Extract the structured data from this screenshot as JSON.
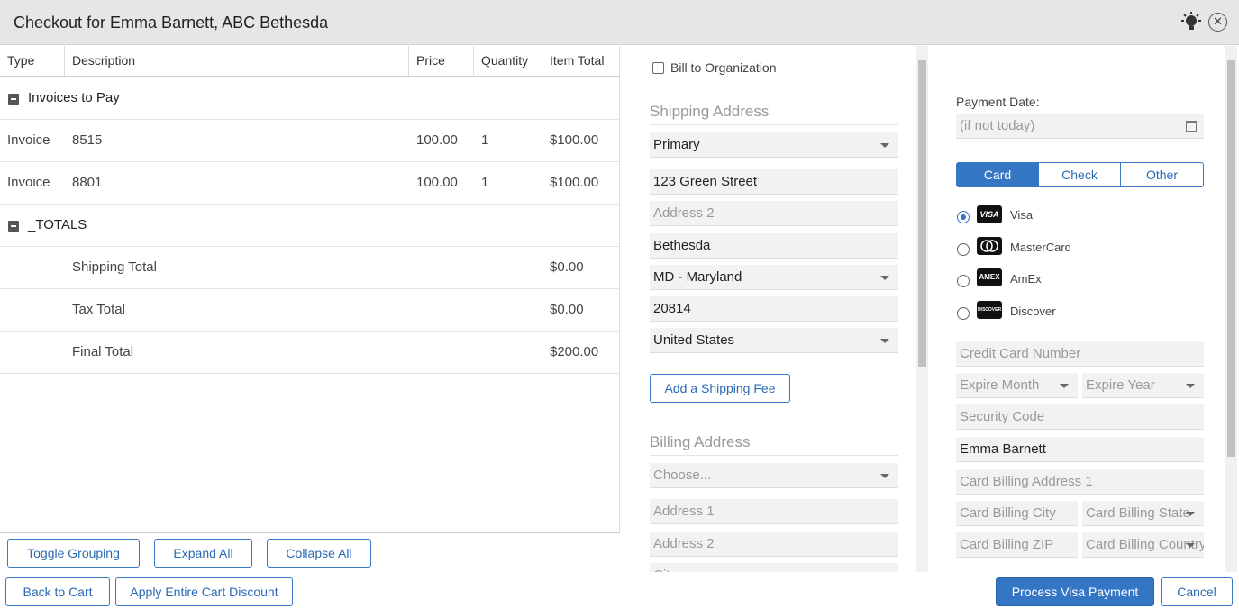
{
  "window": {
    "title": "Checkout for Emma Barnett, ABC Bethesda"
  },
  "table": {
    "headers": [
      "Type",
      "Description",
      "Price",
      "Quantity",
      "Item Total"
    ],
    "groups": [
      {
        "label": "Invoices to Pay",
        "rows": [
          {
            "type": "Invoice",
            "description": "8515",
            "price": "100.00",
            "quantity": "1",
            "total": "$100.00"
          },
          {
            "type": "Invoice",
            "description": "8801",
            "price": "100.00",
            "quantity": "1",
            "total": "$100.00"
          }
        ]
      },
      {
        "label": "_TOTALS",
        "rows": [
          {
            "type": "",
            "description": "Shipping Total",
            "price": "",
            "quantity": "",
            "total": "$0.00"
          },
          {
            "type": "",
            "description": "Tax Total",
            "price": "",
            "quantity": "",
            "total": "$0.00"
          },
          {
            "type": "",
            "description": "Final Total",
            "price": "",
            "quantity": "",
            "total": "$200.00"
          }
        ]
      }
    ],
    "buttons": {
      "toggle_grouping": "Toggle Grouping",
      "expand_all": "Expand All",
      "collapse_all": "Collapse All"
    }
  },
  "shipping": {
    "bill_to_org_label": "Bill to Organization",
    "heading": "Shipping Address",
    "address_type": "Primary",
    "address1": "123 Green Street",
    "address2_placeholder": "Address 2",
    "city": "Bethesda",
    "state": "MD - Maryland",
    "zip": "20814",
    "country": "United States",
    "add_fee_button": "Add a Shipping Fee"
  },
  "billing": {
    "heading": "Billing Address",
    "choose_placeholder": "Choose...",
    "address1_placeholder": "Address 1",
    "address2_placeholder": "Address 2",
    "city_placeholder": "City"
  },
  "payment": {
    "date_label": "Payment Date:",
    "date_placeholder": "(if not today)",
    "tabs": [
      "Card",
      "Check",
      "Other"
    ],
    "selected_tab": "Card",
    "cards": [
      {
        "name": "Visa",
        "logo": "VISA",
        "selected": true
      },
      {
        "name": "MasterCard",
        "logo": "MC",
        "selected": false
      },
      {
        "name": "AmEx",
        "logo": "AMEX",
        "selected": false
      },
      {
        "name": "Discover",
        "logo": "DISCOVER",
        "selected": false
      }
    ],
    "card_number_placeholder": "Credit Card Number",
    "expire_month_placeholder": "Expire Month",
    "expire_year_placeholder": "Expire Year",
    "security_code_placeholder": "Security Code",
    "cardholder_name": "Emma Barnett",
    "billing_address1_placeholder": "Card Billing Address 1",
    "billing_city_placeholder": "Card Billing City",
    "billing_state_placeholder": "Card Billing State",
    "billing_zip_placeholder": "Card Billing ZIP",
    "billing_country_placeholder": "Card Billing Country"
  },
  "footer": {
    "back_to_cart": "Back to Cart",
    "apply_discount": "Apply Entire Cart Discount",
    "process_payment": "Process Visa Payment",
    "cancel": "Cancel"
  },
  "colors": {
    "accent": "#3475c4",
    "titlebar": "#e6e6e6",
    "field_bg": "#f2f2f2"
  }
}
